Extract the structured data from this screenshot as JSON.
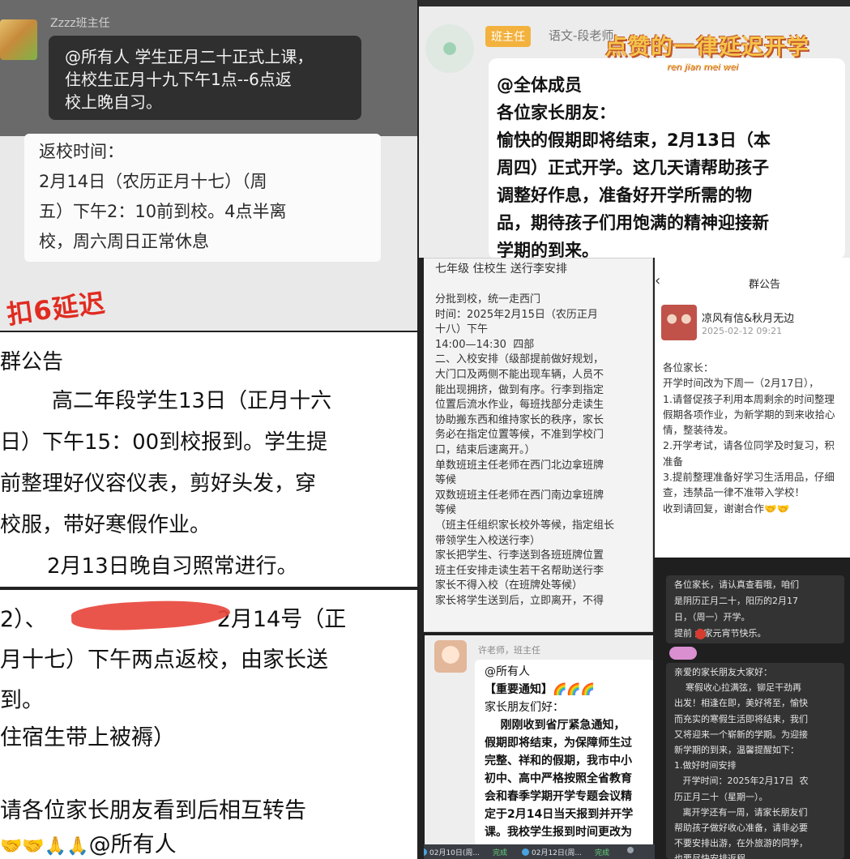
{
  "panel1": {
    "sender": "Zzzz班主任",
    "bubble_dark": "@所有人 学生正月二十正式上课，\n住校生正月十九下午1点--6点返\n校上晚自习。",
    "bubble_light": "返校时间：\n2月14日（农历正月十七）（周\n五）下午2：10前到校。4点半离\n校，周六周日正常休息",
    "stamp": "扣6延迟"
  },
  "panel2": {
    "role_badge": "班主任",
    "sender": "语文-段老师",
    "overlay_title": "点赞的一律延迟开学",
    "overlay_sub": "ren jian mei wei",
    "bubble": "@全体成员\n各位家长朋友：\n愉快的假期即将结束，2月13日（本\n周四）正式开学。这几天请帮助孩子\n调整好作息，准备好开学所需的物\n品，期待孩子们用饱满的精神迎接新\n学期的到来。"
  },
  "panel3": {
    "title": "群公告",
    "line1": "高二年段学生13日（正月十六",
    "line2": "日）下午15：00到校报到。学生提",
    "line3": "前整理好仪容仪表，剪好头发，穿",
    "line4": "校服，带好寒假作业。",
    "line5": "2月13日晚自习照常进行。"
  },
  "panel4": {
    "line1_prefix": "2）、",
    "line1_suffix": "2月14号（正",
    "line2": "月十七）下午两点返校，由家长送",
    "line3": "到。",
    "line4": "住宿生带上被褥）",
    "line5": "请各位家长朋友看到后相互转告",
    "line6_emoji": "🤝🤝🙏🙏",
    "line6_text": "@所有人"
  },
  "panel5": {
    "head": "七年级 住校生 送行李安排",
    "body": "分批到校，统一走西门\n时间：2025年2月15日（农历正月\n十八）下午\n14:00—14:30  四部\n二、入校安排（级部提前做好规划，\n大门口及两侧不能出现车辆，人员不\n能出现拥挤，做到有序。行李到指定\n位置后流水作业，每班找部分走读生\n协助搬东西和维持家长的秩序，家长\n务必在指定位置等候，不准到学校门\n口，结束后速离开。）\n单数班班主任老师在西门北边拿班牌\n等候\n双数班班主任老师在西门南边拿班牌\n等候\n（班主任组织家长校外等候，指定组长\n带领学生入校送行李）\n家长把学生、行李送到各班班牌位置\n班主任安排走读生若干名帮助送行李\n家长不得入校（在班牌处等候）\n家长将学生送到后，立即离开，不得"
  },
  "panel6": {
    "back": "‹",
    "title": "群公告",
    "name": "凉风有信&秋月无边",
    "date": "2025-02-12 09:21",
    "body": "各位家长：\n开学时间改为下周一（2月17日），\n1.请督促孩子利用本周剩余的时间整理\n假期各项作业，为新学期的到来收拾心\n情，整装待发。\n2.开学考试，请各位同学及时复习，积\n准备\n3.提前整理准备好学习生活用品，仔细\n查，违禁品一律不准带入学校！\n收到请回复，谢谢合作🤝🤝"
  },
  "panel7": {
    "bubble1_line1": "各位家长，请认真查看哦，咱们",
    "bubble1_line2": "是阴历正月二十，阳历的2月17",
    "bubble1_line3": "日，（周一）开学。",
    "bubble1_line4": "提前  大家元宵节快乐。",
    "bubble2": "亲爱的家长朋友大家好：\n    寒假收心拉满弦，铆足干劲再\n出发！相逢在即，美好将至，愉快\n而充实的寒假生活即将结束，我们\n又将迎来一个崭新的学期。为迎接\n新学期的到来，温馨提醒如下：\n1.做好时间安排\n   开学时间：2025年2月17日  农\n历正月二十（星期一）。\n   离开学还有一周，请家长朋友们\n帮助孩子做好收心准备，请非必要\n不要安排出游，在外旅游的同学，\n也要尽快安排返程。"
  },
  "panel8": {
    "sender": "许老师，班主任",
    "line1": "@所有人",
    "line2": "【重要通知】🌈🌈🌈",
    "line3": "家长朋友们好：",
    "body": "    刚刚收到省厅紧急通知，\n假期即将结束，为保障师生过\n完整、祥和的假期，我市中小\n初中、高中严格按照全省教育\n会和春季学期开学专题会议精\n定于2月14日当天报到并开学\n课。我校学生报到时间更改为"
  },
  "taskbar": {
    "item1": "02月10日(周...",
    "item1_status": "完成",
    "item2": "02月12日(周...",
    "item2_status": "完成"
  },
  "colors": {
    "stamp_red": "#e02b20",
    "badge_orange": "#f3b23e",
    "overlay_yellow": "#f6c34a",
    "dark_bubble": "#2f2f2f"
  }
}
